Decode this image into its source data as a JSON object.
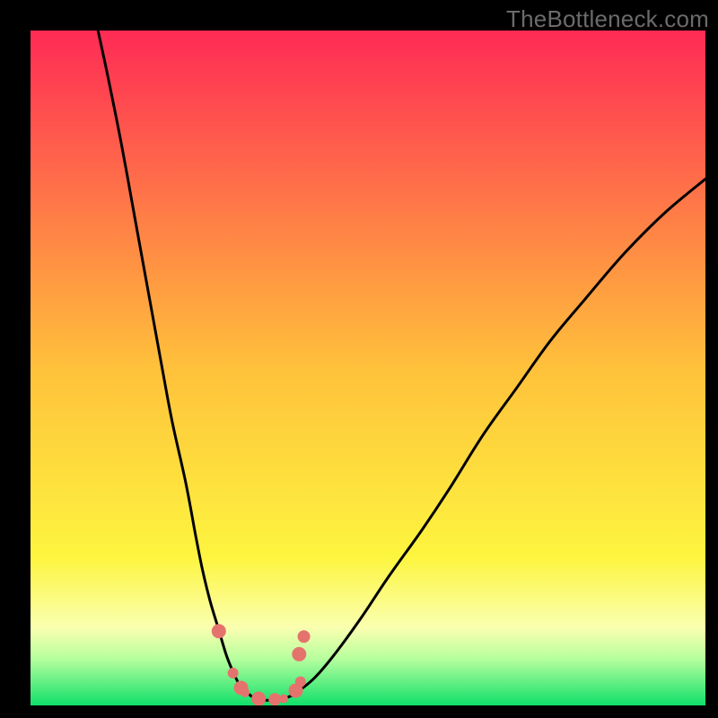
{
  "watermark": "TheBottleneck.com",
  "domain": "Chart",
  "chart_data": {
    "type": "line",
    "title": "",
    "xlabel": "",
    "ylabel": "",
    "xlim": [
      0,
      100
    ],
    "ylim": [
      0,
      100
    ],
    "background_gradient": {
      "stops": [
        {
          "offset": 0.0,
          "color": "#ff2a55"
        },
        {
          "offset": 0.5,
          "color": "#ffc13b"
        },
        {
          "offset": 0.78,
          "color": "#fdf53f"
        },
        {
          "offset": 0.885,
          "color": "#faffb0"
        },
        {
          "offset": 0.93,
          "color": "#b8ff9e"
        },
        {
          "offset": 1.0,
          "color": "#10e06a"
        }
      ]
    },
    "series": [
      {
        "name": "left_branch",
        "x": [
          10.0,
          11.5,
          13.5,
          15.5,
          17.5,
          19.5,
          21.0,
          23.0,
          24.5,
          25.5,
          26.6,
          27.8,
          29.0,
          30.0,
          31.0,
          32.0
        ],
        "y": [
          100.0,
          93.0,
          83.0,
          72.0,
          61.0,
          50.0,
          42.0,
          33.0,
          25.0,
          20.0,
          15.5,
          11.5,
          7.5,
          5.0,
          3.0,
          2.0
        ]
      },
      {
        "name": "valley",
        "x": [
          32.0,
          33.0,
          34.5,
          36.0,
          37.5,
          39.0
        ],
        "y": [
          2.0,
          1.2,
          0.8,
          0.8,
          1.0,
          1.6
        ]
      },
      {
        "name": "right_branch",
        "x": [
          39.0,
          42.0,
          45.0,
          49.0,
          53.0,
          58.0,
          62.0,
          67.0,
          72.0,
          77.0,
          82.0,
          88.0,
          94.0,
          100.0
        ],
        "y": [
          1.6,
          4.0,
          7.5,
          13.0,
          19.0,
          26.0,
          32.0,
          40.0,
          47.0,
          54.0,
          60.0,
          67.0,
          73.0,
          78.0
        ]
      }
    ],
    "markers": {
      "name": "scatter_points",
      "color": "#e5736d",
      "points": [
        {
          "x": 27.9,
          "y": 11.0,
          "r": 8
        },
        {
          "x": 30.0,
          "y": 4.8,
          "r": 6
        },
        {
          "x": 31.2,
          "y": 2.6,
          "r": 8
        },
        {
          "x": 31.8,
          "y": 1.9,
          "r": 5
        },
        {
          "x": 33.8,
          "y": 1.0,
          "r": 8
        },
        {
          "x": 36.2,
          "y": 0.9,
          "r": 7
        },
        {
          "x": 37.5,
          "y": 1.0,
          "r": 5
        },
        {
          "x": 39.3,
          "y": 2.2,
          "r": 8
        },
        {
          "x": 40.0,
          "y": 3.5,
          "r": 6
        },
        {
          "x": 39.8,
          "y": 7.6,
          "r": 8
        },
        {
          "x": 40.5,
          "y": 10.2,
          "r": 7
        }
      ]
    }
  }
}
